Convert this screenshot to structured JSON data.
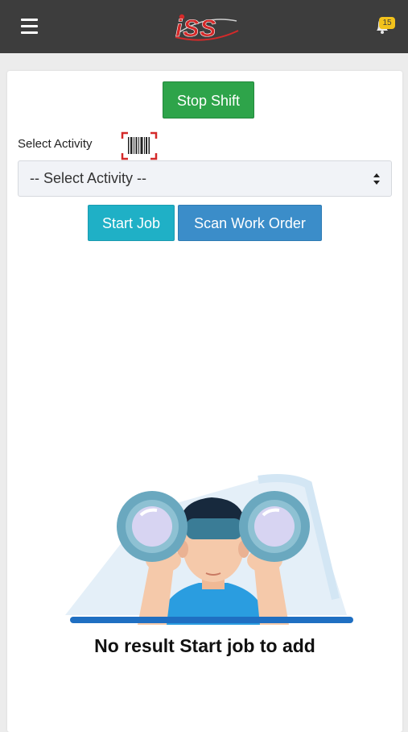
{
  "header": {
    "logo_text": "iSS",
    "notification_count": "15"
  },
  "content": {
    "stop_shift_label": "Stop Shift",
    "select_activity_label": "Select Activity",
    "activity_select": {
      "selected": "-- Select Activity --"
    },
    "start_job_label": "Start Job",
    "scan_work_order_label": "Scan Work Order",
    "empty_state_message": "No result Start job to add"
  },
  "colors": {
    "header_bg": "#3d3d3d",
    "stop_shift": "#2ea44a",
    "start_job": "#1fb0c6",
    "scan_work_order": "#3b8dc9",
    "badge": "#f2c21b",
    "brand_red": "#d42a2a"
  },
  "icons": {
    "menu": "hamburger-menu-icon",
    "notifications": "bell-icon",
    "barcode": "barcode-scan-icon",
    "select_arrows": "sort-arrows-icon"
  }
}
